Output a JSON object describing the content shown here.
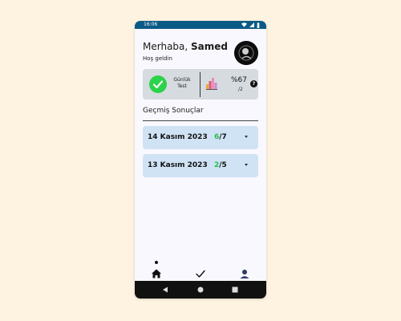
{
  "status": {
    "time": "16:06"
  },
  "header": {
    "greeting_prefix": "Merhaba, ",
    "user_name": "Samed",
    "welcome": "Hoş geldin"
  },
  "summary": {
    "daily_test_line1": "Günlük",
    "daily_test_line2": "Test",
    "success_percent": "%67",
    "success_sub": "/2",
    "help_label": "?"
  },
  "history": {
    "title": "Geçmiş Sonuçlar",
    "results": [
      {
        "date": "14 Kasım 2023",
        "correct": "6",
        "total": "/7"
      },
      {
        "date": "13 Kasım 2023",
        "correct": "2",
        "total": "/5"
      }
    ]
  },
  "colors": {
    "status_bar": "#0a5a86",
    "accent_green": "#23c14a",
    "card_bg": "#cfe3f5",
    "summary_bg": "#d6dbe0"
  },
  "icons": {
    "status": [
      "wifi-icon",
      "signal-icon",
      "battery-icon"
    ],
    "nav": [
      "home-icon",
      "check-icon",
      "person-icon"
    ],
    "system": [
      "back-icon",
      "home-circle-icon",
      "recents-icon"
    ]
  }
}
